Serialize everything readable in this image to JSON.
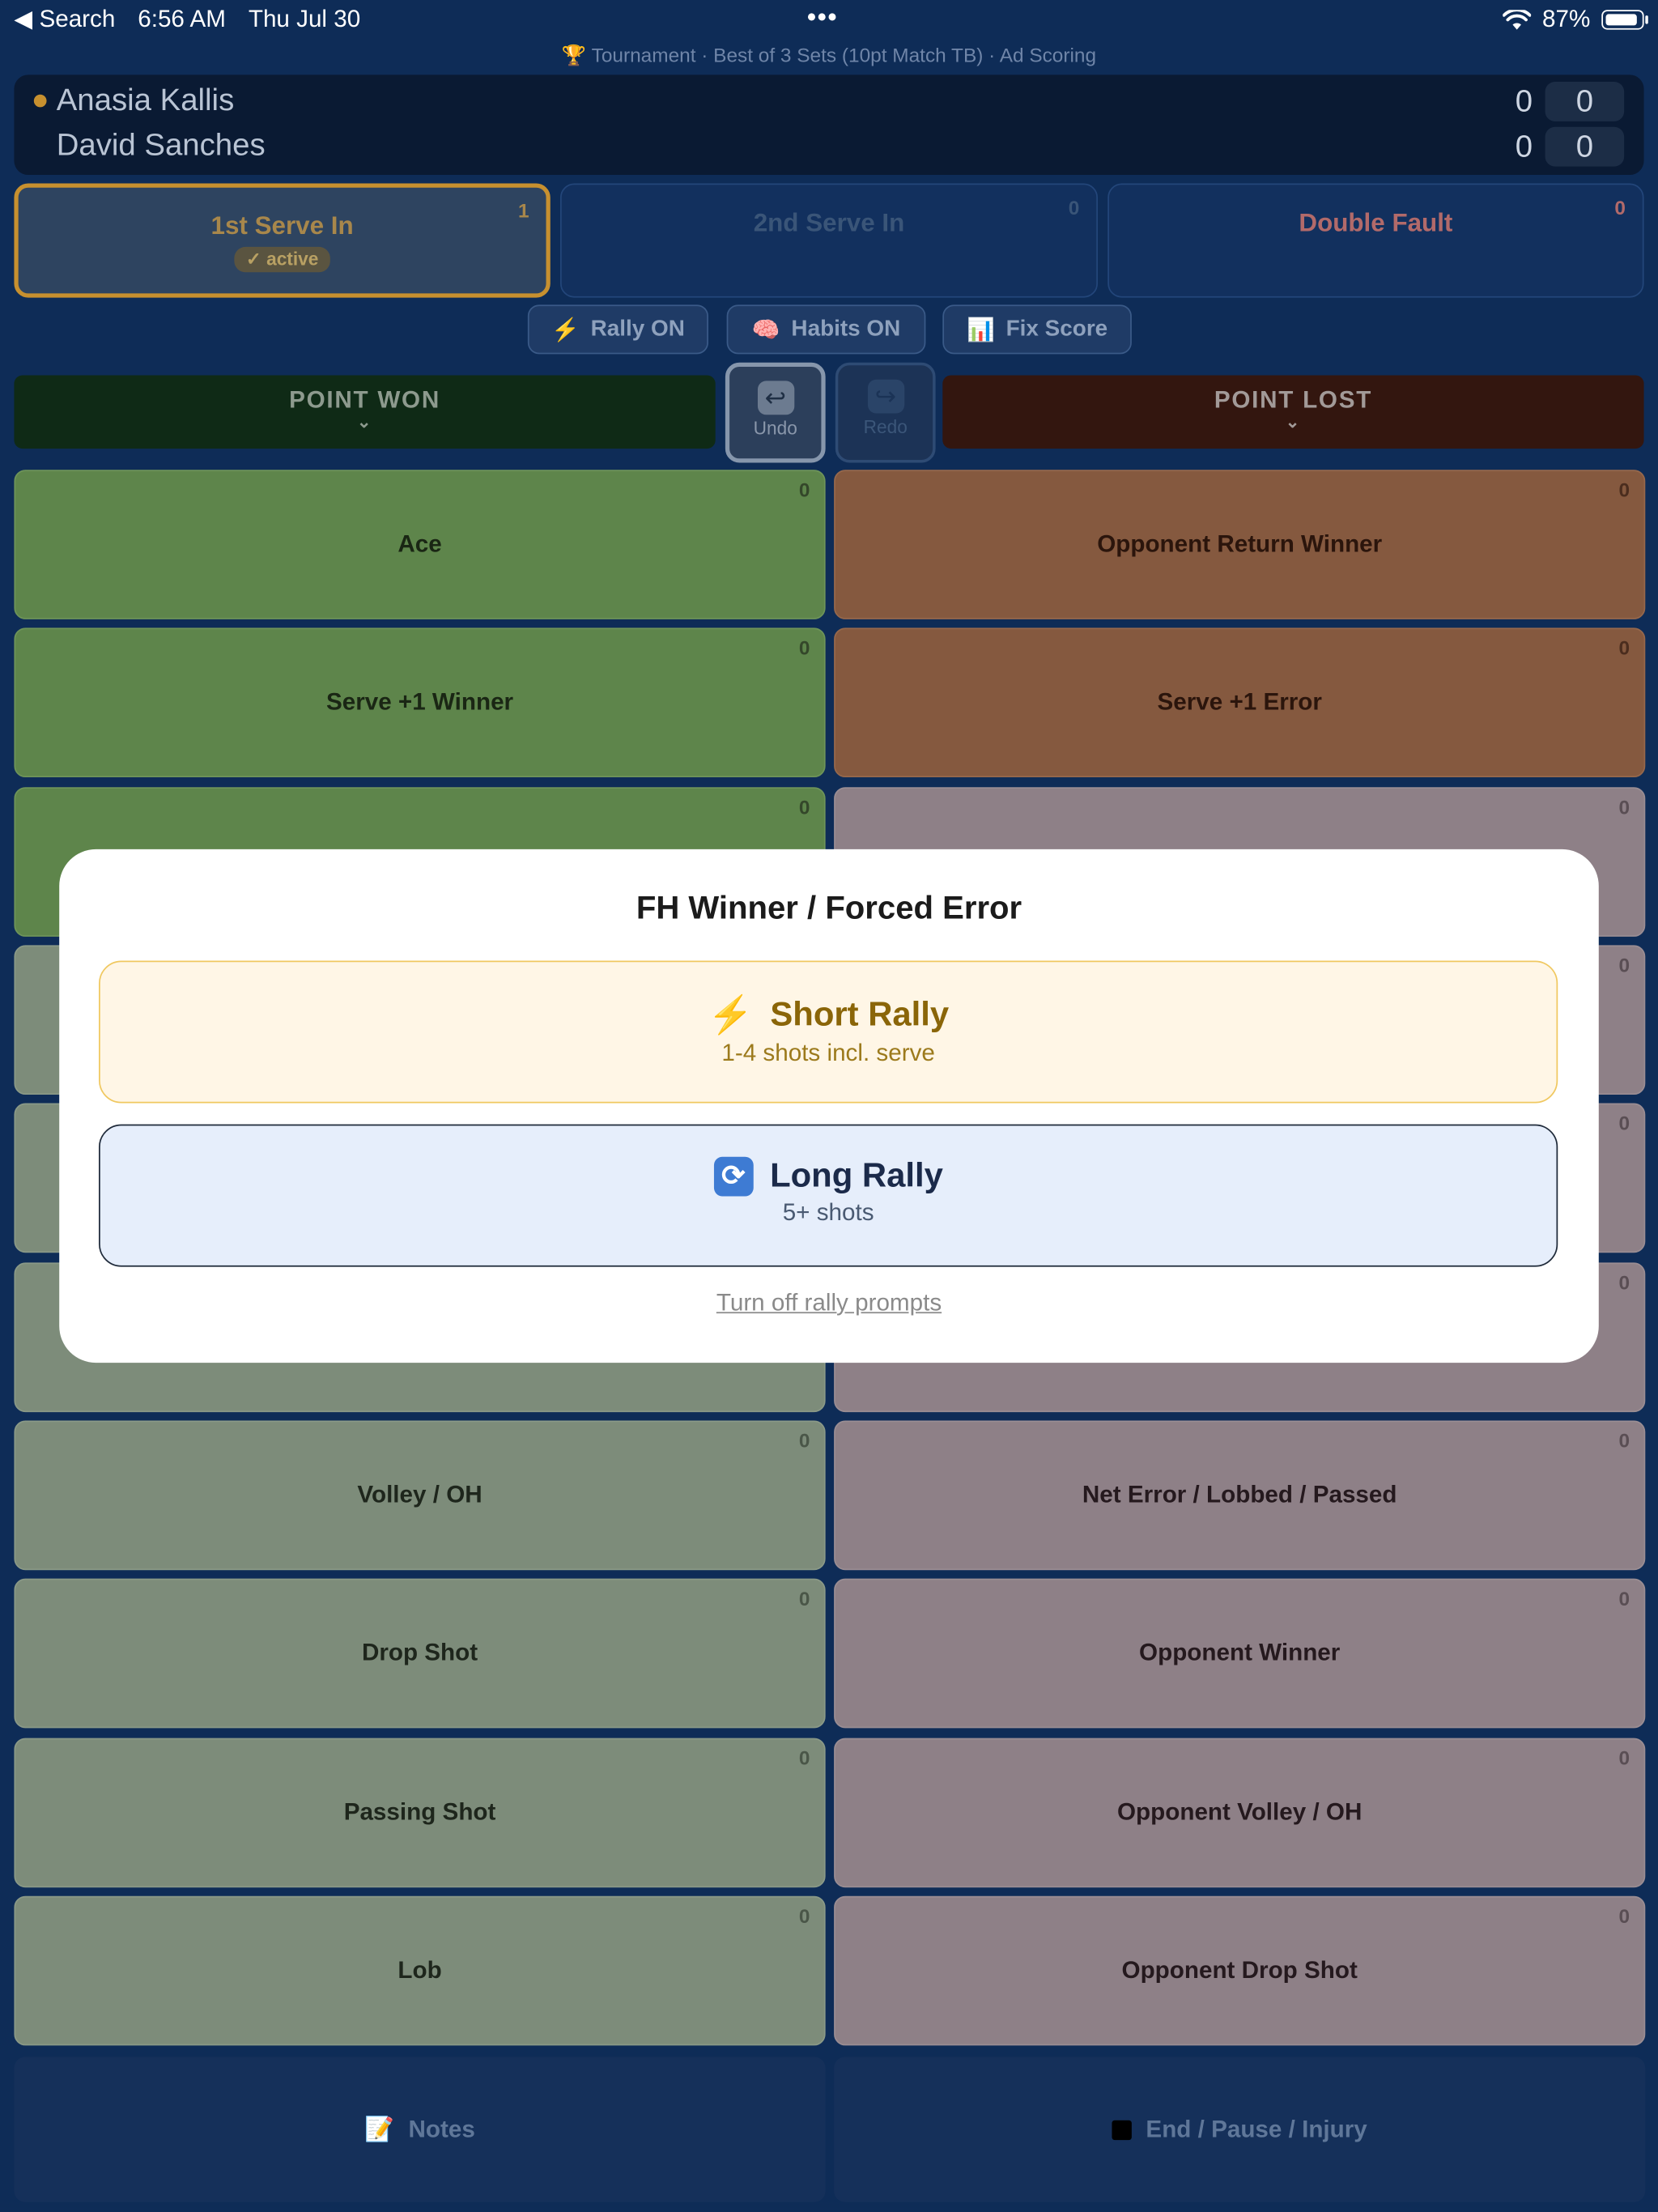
{
  "status_bar": {
    "back_label": "◀ Search",
    "time": "6:56 AM",
    "date": "Thu Jul 30",
    "multitask_dots": "•••",
    "battery_percent": "87%",
    "battery_level": 0.87
  },
  "match_info": "Tournament · Best of 3 Sets (10pt Match TB) · Ad Scoring",
  "scoreboard": {
    "player1": {
      "name": "Anasia Kallis",
      "set": "0",
      "game": "0",
      "serving": true
    },
    "player2": {
      "name": "David Sanches",
      "set": "0",
      "game": "0",
      "serving": false
    }
  },
  "serve_tiles": [
    {
      "label": "1st Serve In",
      "count": "1",
      "badge": "✓ active"
    },
    {
      "label": "2nd Serve In",
      "count": "0"
    },
    {
      "label": "Double Fault",
      "count": "0"
    }
  ],
  "toggles": {
    "rally": "Rally ON",
    "habits": "Habits ON",
    "fix_score": "Fix Score"
  },
  "headers": {
    "won": "POINT WON",
    "lost": "POINT LOST",
    "chevron": "⌄"
  },
  "undo_label": "Undo",
  "redo_label": "Redo",
  "won_tiles": [
    {
      "label": "Ace",
      "count": "0"
    },
    {
      "label": "Serve +1 Winner",
      "count": "0"
    },
    {
      "label": "",
      "count": "0"
    },
    {
      "label": "",
      "count": ""
    },
    {
      "label": "",
      "count": ""
    },
    {
      "label": "",
      "count": ""
    },
    {
      "label": "Volley / OH",
      "count": "0"
    },
    {
      "label": "Drop Shot",
      "count": "0"
    },
    {
      "label": "Passing Shot",
      "count": "0"
    },
    {
      "label": "Lob",
      "count": "0"
    }
  ],
  "lost_tiles": [
    {
      "label": "Opponent Return Winner",
      "count": "0"
    },
    {
      "label": "Serve +1 Error",
      "count": "0"
    },
    {
      "label": "",
      "count": "0"
    },
    {
      "label": "",
      "count": "0"
    },
    {
      "label": "",
      "count": "0"
    },
    {
      "label": "",
      "count": "0"
    },
    {
      "label": "Net Error / Lobbed / Passed",
      "count": "0"
    },
    {
      "label": "Opponent Winner",
      "count": "0"
    },
    {
      "label": "Opponent Volley / OH",
      "count": "0"
    },
    {
      "label": "Opponent Drop Shot",
      "count": "0"
    }
  ],
  "bottom": {
    "notes": "Notes",
    "end": "End / Pause / Injury"
  },
  "modal": {
    "title": "FH Winner / Forced Error",
    "short": {
      "title": "Short Rally",
      "subtitle": "1-4 shots incl. serve"
    },
    "long": {
      "title": "Long Rally",
      "subtitle": "5+ shots"
    },
    "turn_off": "Turn off rally prompts"
  },
  "icons": {
    "trophy": "trophy-icon",
    "bolt": "lightning-bolt-icon",
    "brain": "brain-icon",
    "chart": "bar-chart-icon",
    "undo": "undo-arrow-icon",
    "redo": "redo-arrow-icon",
    "notes": "memo-icon",
    "end": "stop-square-icon",
    "cycle": "cycle-arrows-icon"
  },
  "colors": {
    "accent_gold": "#c7902f",
    "won_green": "#5e854b",
    "lost_brown": "#85593f",
    "background": "#0e2c57"
  }
}
